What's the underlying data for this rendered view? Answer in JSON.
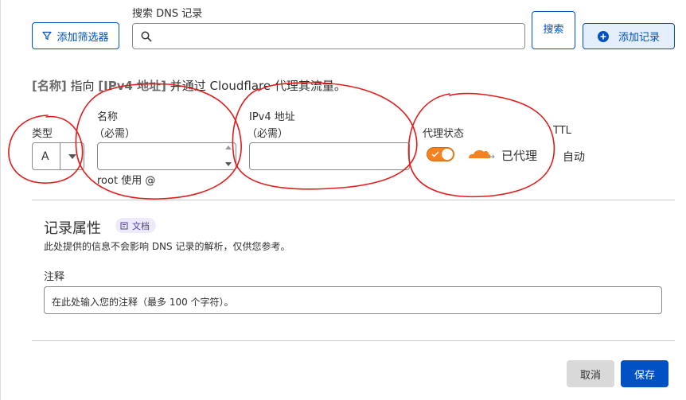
{
  "toolbar": {
    "filter_button": "添加筛选器",
    "search_label": "搜索 DNS 记录",
    "search_value": "",
    "search_button": "搜索",
    "add_record_button": "添加记录"
  },
  "form": {
    "summary_name": "[名称]",
    "summary_mid": " 指向 ",
    "summary_target": "[IPv4 地址]",
    "summary_end": " 并通过 Cloudflare 代理其流量。",
    "type_label": "类型",
    "type_value": "A",
    "name_label": "名称",
    "name_required": "（必需）",
    "name_value": "",
    "name_hint": "root 使用 @",
    "ipv4_label": "IPv4 地址",
    "ipv4_required": "（必需）",
    "ipv4_value": "",
    "proxy_label": "代理状态",
    "proxy_status": "已代理",
    "proxy_on": true,
    "ttl_label": "TTL",
    "ttl_value": "自动"
  },
  "attributes": {
    "title": "记录属性",
    "doc_badge": "文档",
    "description": "此处提供的信息不会影响 DNS 记录的解析，仅供您参考。",
    "comment_label": "注释",
    "comment_placeholder": "在此处输入您的注释（最多 100 个字符）。"
  },
  "footer": {
    "cancel_button": "取消",
    "save_button": "保存"
  },
  "colors": {
    "accent": "#0051c3",
    "cloud": "#f6821f",
    "annotation": "#e31b1b"
  }
}
